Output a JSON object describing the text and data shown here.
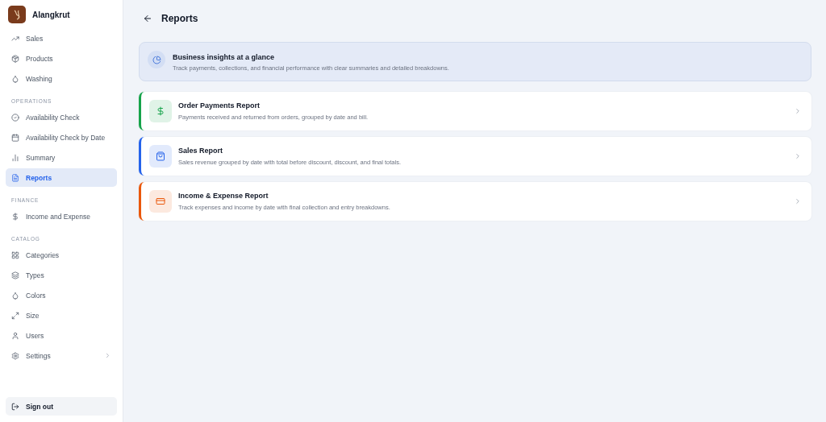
{
  "brand": {
    "name": "Alangkrut"
  },
  "sidebar": {
    "sections": [
      {
        "items": [
          {
            "label": "Sales",
            "selected": false,
            "kind": "link"
          },
          {
            "label": "Products",
            "selected": false,
            "kind": "link"
          },
          {
            "label": "Washing",
            "selected": false,
            "kind": "link"
          }
        ]
      },
      {
        "title": "OPERATIONS",
        "items": [
          {
            "label": "Availability Check",
            "selected": false,
            "kind": "link"
          },
          {
            "label": "Availability Check by Date",
            "selected": false,
            "kind": "link"
          },
          {
            "label": "Summary",
            "selected": false,
            "kind": "link"
          },
          {
            "label": "Reports",
            "selected": true,
            "kind": "link"
          }
        ]
      },
      {
        "title": "FINANCE",
        "items": [
          {
            "label": "Income and Expense",
            "selected": false,
            "kind": "link"
          }
        ]
      },
      {
        "title": "CATALOG",
        "items": [
          {
            "label": "Categories",
            "selected": false,
            "kind": "link"
          },
          {
            "label": "Types",
            "selected": false,
            "kind": "link"
          },
          {
            "label": "Colors",
            "selected": false,
            "kind": "link"
          },
          {
            "label": "Size",
            "selected": false,
            "kind": "link"
          },
          {
            "label": "Users",
            "selected": false,
            "kind": "link"
          },
          {
            "label": "Settings",
            "selected": false,
            "kind": "submenu"
          }
        ]
      }
    ],
    "sign_out": "Sign out"
  },
  "page": {
    "title": "Reports"
  },
  "banner": {
    "title": "Business insights at a glance",
    "text": "Track payments, collections, and financial performance with clear summaries and detailed breakdowns."
  },
  "reports": [
    {
      "title": "Order Payments Report",
      "text": "Payments received and returned from orders, grouped by date and bill.",
      "color": "#16a34a"
    },
    {
      "title": "Sales Report",
      "text": "Sales revenue grouped by date with total before discount, discount, and final totals.",
      "color": "#2563eb"
    },
    {
      "title": "Income & Expense Report",
      "text": "Track expenses and income by date with final collection and entry breakdowns.",
      "color": "#ea580c"
    }
  ]
}
